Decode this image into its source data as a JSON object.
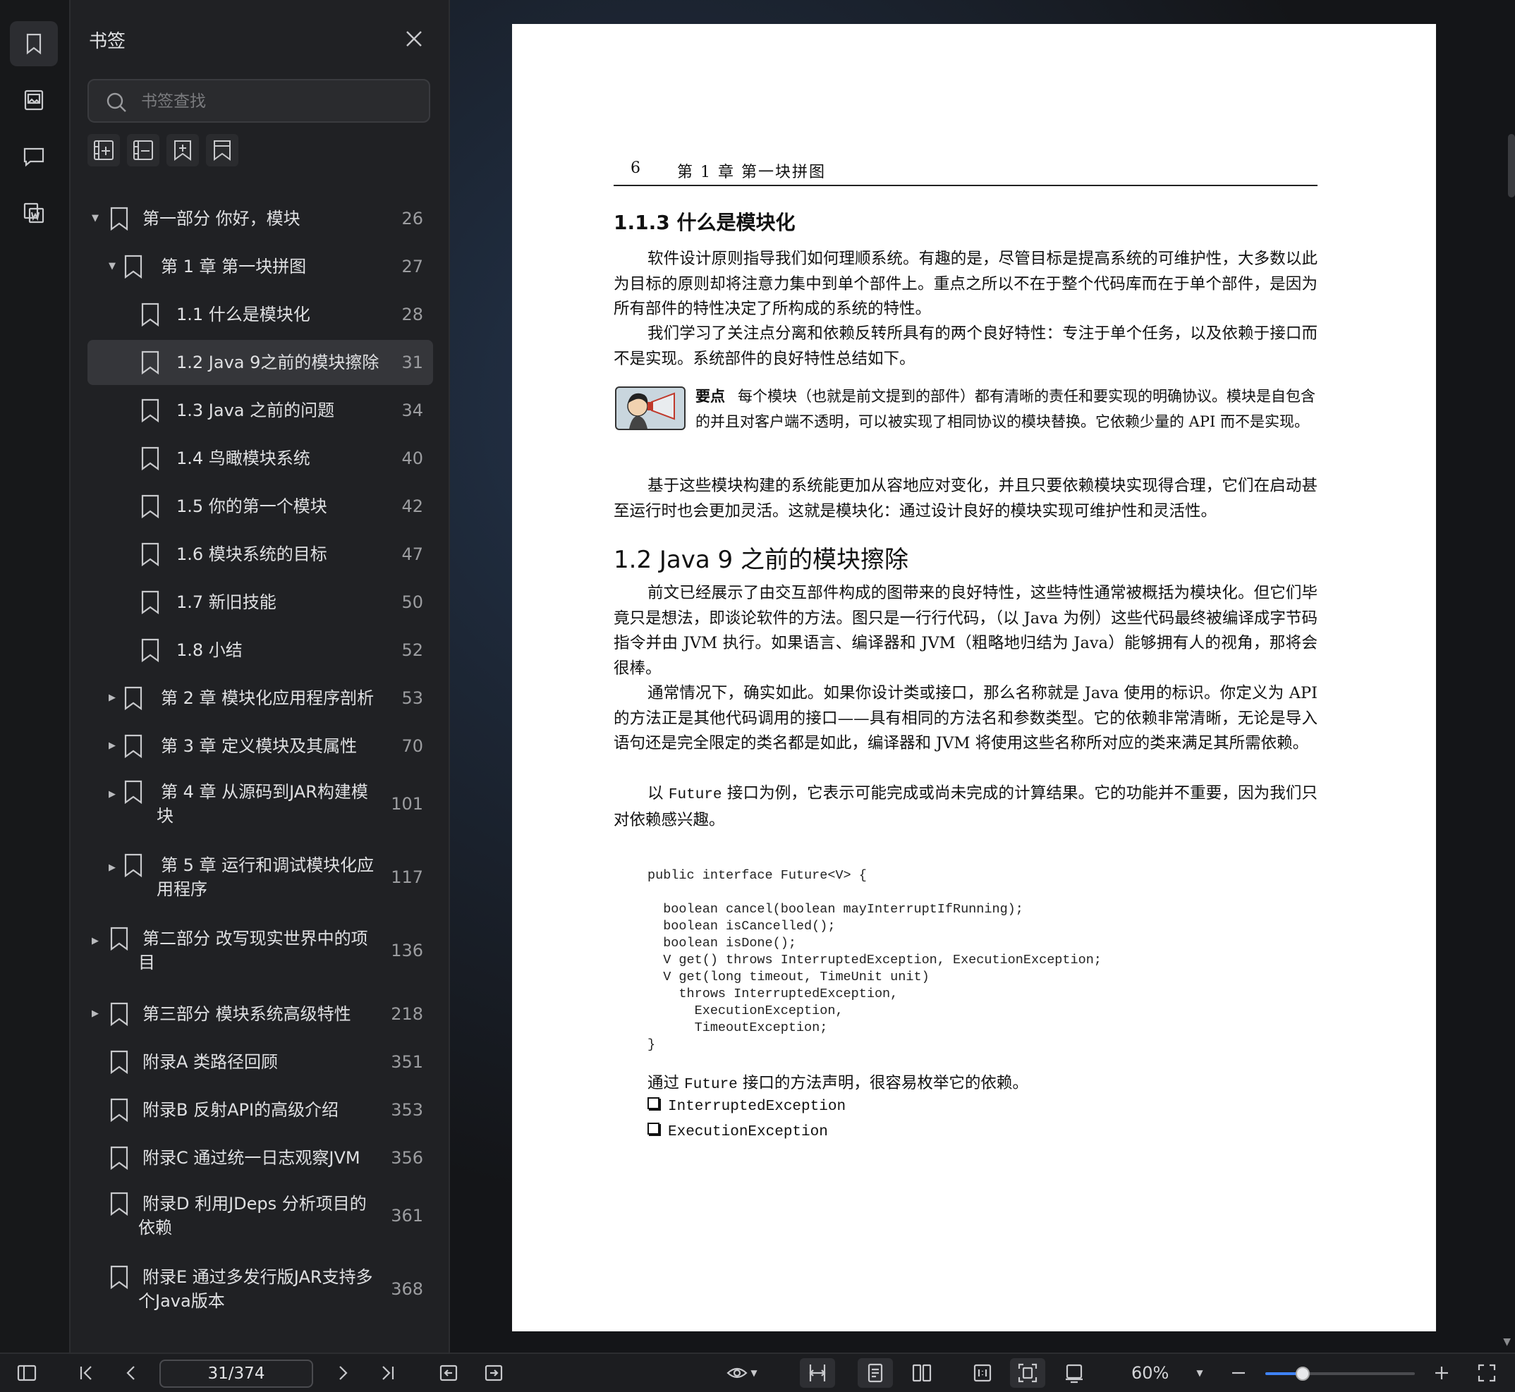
{
  "panel": {
    "title": "书签",
    "search_placeholder": "书签查找"
  },
  "bookmarks": [
    {
      "label": "第一部分 你好，模块",
      "page": "26",
      "level": 0,
      "expandable": true,
      "expanded": true
    },
    {
      "label": "第 1 章  第一块拼图",
      "page": "27",
      "level": 1,
      "expandable": true,
      "expanded": true
    },
    {
      "label": "1.1 什么是模块化",
      "page": "28",
      "level": 2
    },
    {
      "label": "1.2 Java 9之前的模块擦除",
      "page": "31",
      "level": 2,
      "selected": true
    },
    {
      "label": "1.3 Java 之前的问题",
      "page": "34",
      "level": 2
    },
    {
      "label": "1.4 鸟瞰模块系统",
      "page": "40",
      "level": 2
    },
    {
      "label": "1.5 你的第一个模块",
      "page": "42",
      "level": 2
    },
    {
      "label": "1.6 模块系统的目标",
      "page": "47",
      "level": 2
    },
    {
      "label": "1.7 新旧技能",
      "page": "50",
      "level": 2
    },
    {
      "label": "1.8 小结",
      "page": "52",
      "level": 2
    },
    {
      "label": "第 2 章  模块化应用程序剖析",
      "page": "53",
      "level": 1,
      "expandable": true
    },
    {
      "label": "第 3 章  定义模块及其属性",
      "page": "70",
      "level": 1,
      "expandable": true
    },
    {
      "label": "第 4 章  从源码到JAR构建模",
      "label2": "块",
      "page": "101",
      "level": 1,
      "expandable": true
    },
    {
      "label": "第 5 章  运行和调试模块化应",
      "label2": "用程序",
      "page": "117",
      "level": 1,
      "expandable": true
    },
    {
      "label": "第二部分 改写现实世界中的项",
      "label2": "目",
      "page": "136",
      "level": 0,
      "expandable": true
    },
    {
      "label": "第三部分 模块系统高级特性",
      "page": "218",
      "level": 0,
      "expandable": true
    },
    {
      "label": "附录A 类路径回顾",
      "page": "351",
      "level": 0
    },
    {
      "label": "附录B 反射API的高级介绍",
      "page": "353",
      "level": 0
    },
    {
      "label": "附录C 通过统一日志观察JVM",
      "page": "356",
      "level": 0
    },
    {
      "label": "附录D 利用JDeps 分析项目的",
      "label2": "依赖",
      "page": "361",
      "level": 0
    },
    {
      "label": "附录E 通过多发行版JAR支持多",
      "label2": "个Java版本",
      "page": "368",
      "level": 0
    }
  ],
  "document": {
    "running_page": "6",
    "running_chapter": "第 1 章   第一块拼图",
    "h3": "1.1.3   什么是模块化",
    "p1": "软件设计原则指导我们如何理顺系统。有趣的是，尽管目标是提高系统的可维护性，大多数以此为目标的原则却将注意力集中到单个部件上。重点之所以不在于整个代码库而在于单个部件，是因为所有部件的特性决定了所构成的系统的特性。",
    "p2": "我们学习了关注点分离和依赖反转所具有的两个良好特性：专注于单个任务，以及依赖于接口而不是实现。系统部件的良好特性总结如下。",
    "note_label": "要点",
    "note_text": "每个模块（也就是前文提到的部件）都有清晰的责任和要实现的明确协议。模块是自包含的并且对客户端不透明，可以被实现了相同协议的模块替换。它依赖少量的 API 而不是实现。",
    "p3": "基于这些模块构建的系统能更加从容地应对变化，并且只要依赖模块实现得合理，它们在启动甚至运行时也会更加灵活。这就是模块化：通过设计良好的模块实现可维护性和灵活性。",
    "h2": "1.2   Java 9 之前的模块擦除",
    "p4": "前文已经展示了由交互部件构成的图带来的良好特性，这些特性通常被概括为模块化。但它们毕竟只是想法，即谈论软件的方法。图只是一行行代码，（以 Java 为例）这些代码最终被编译成字节码指令并由 JVM 执行。如果语言、编译器和 JVM（粗略地归结为 Java）能够拥有人的视角，那将会很棒。",
    "p5": "通常情况下，确实如此。如果你设计类或接口，那么名称就是 Java 使用的标识。你定义为 API 的方法正是其他代码调用的接口——具有相同的方法名和参数类型。它的依赖非常清晰，无论是导入语句还是完全限定的类名都是如此，编译器和 JVM 将使用这些名称所对应的类来满足其所需依赖。",
    "p6_a": "以 ",
    "p6_code": "Future",
    "p6_b": " 接口为例，它表示可能完成或尚未完成的计算结果。它的功能并不重要，因为我们只对依赖感兴趣。",
    "code": "public interface Future<V> {\n\n  boolean cancel(boolean mayInterruptIfRunning);\n  boolean isCancelled();\n  boolean isDone();\n  V get() throws InterruptedException, ExecutionException;\n  V get(long timeout, TimeUnit unit)\n    throws InterruptedException,\n      ExecutionException,\n      TimeoutException;\n}",
    "p7_a": "通过 ",
    "p7_code": "Future",
    "p7_b": " 接口的方法声明，很容易枚举它的依赖。",
    "bullets": [
      "InterruptedException",
      "ExecutionException"
    ]
  },
  "toolbar": {
    "page_indicator": "31/374",
    "zoom": "60%",
    "zoom_fraction": 0.24
  }
}
